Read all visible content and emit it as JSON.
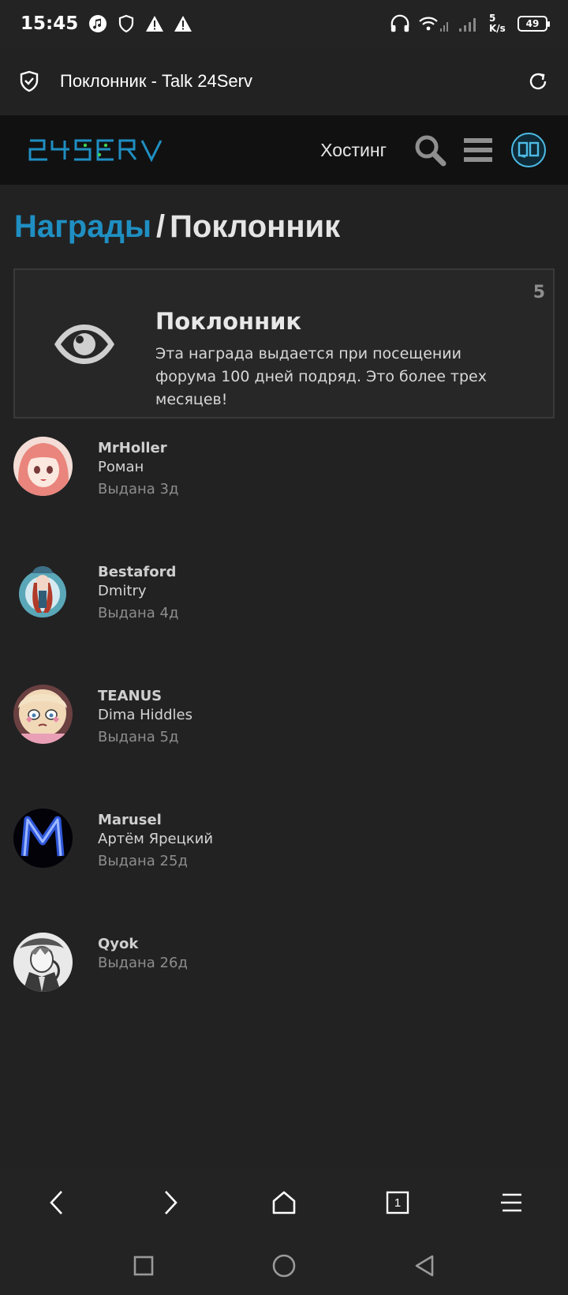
{
  "status_bar": {
    "time": "15:45",
    "speed_value": "5",
    "speed_unit": "K/s",
    "battery": "49"
  },
  "browser": {
    "page_title": "Поклонник - Talk 24Serv"
  },
  "site_header": {
    "logo_text": "24SERV",
    "hosting_link": "Хостинг",
    "accent_color": "#1f8fc2"
  },
  "breadcrumb": {
    "parent": "Награды",
    "separator": "/",
    "current": "Поклонник"
  },
  "award": {
    "title": "Поклонник",
    "description": "Эта награда выдается при посещении форума 100 дней подряд. Это более трех месяцев!",
    "count": "5",
    "icon": "eye-icon"
  },
  "recipients": [
    {
      "username": "MrHoller",
      "real_name": "Роман",
      "granted": "Выдана 3д"
    },
    {
      "username": "Bestaford",
      "real_name": "Dmitry",
      "granted": "Выдана 4д"
    },
    {
      "username": "TEANUS",
      "real_name": "Dima Hiddles",
      "granted": "Выдана 5д"
    },
    {
      "username": "Marusel",
      "real_name": "Артём Ярецкий",
      "granted": "Выдана 25д"
    },
    {
      "username": "Qyok",
      "real_name": "",
      "granted": "Выдана 26д"
    }
  ],
  "bottom_nav": {
    "tabs_count": "1"
  }
}
